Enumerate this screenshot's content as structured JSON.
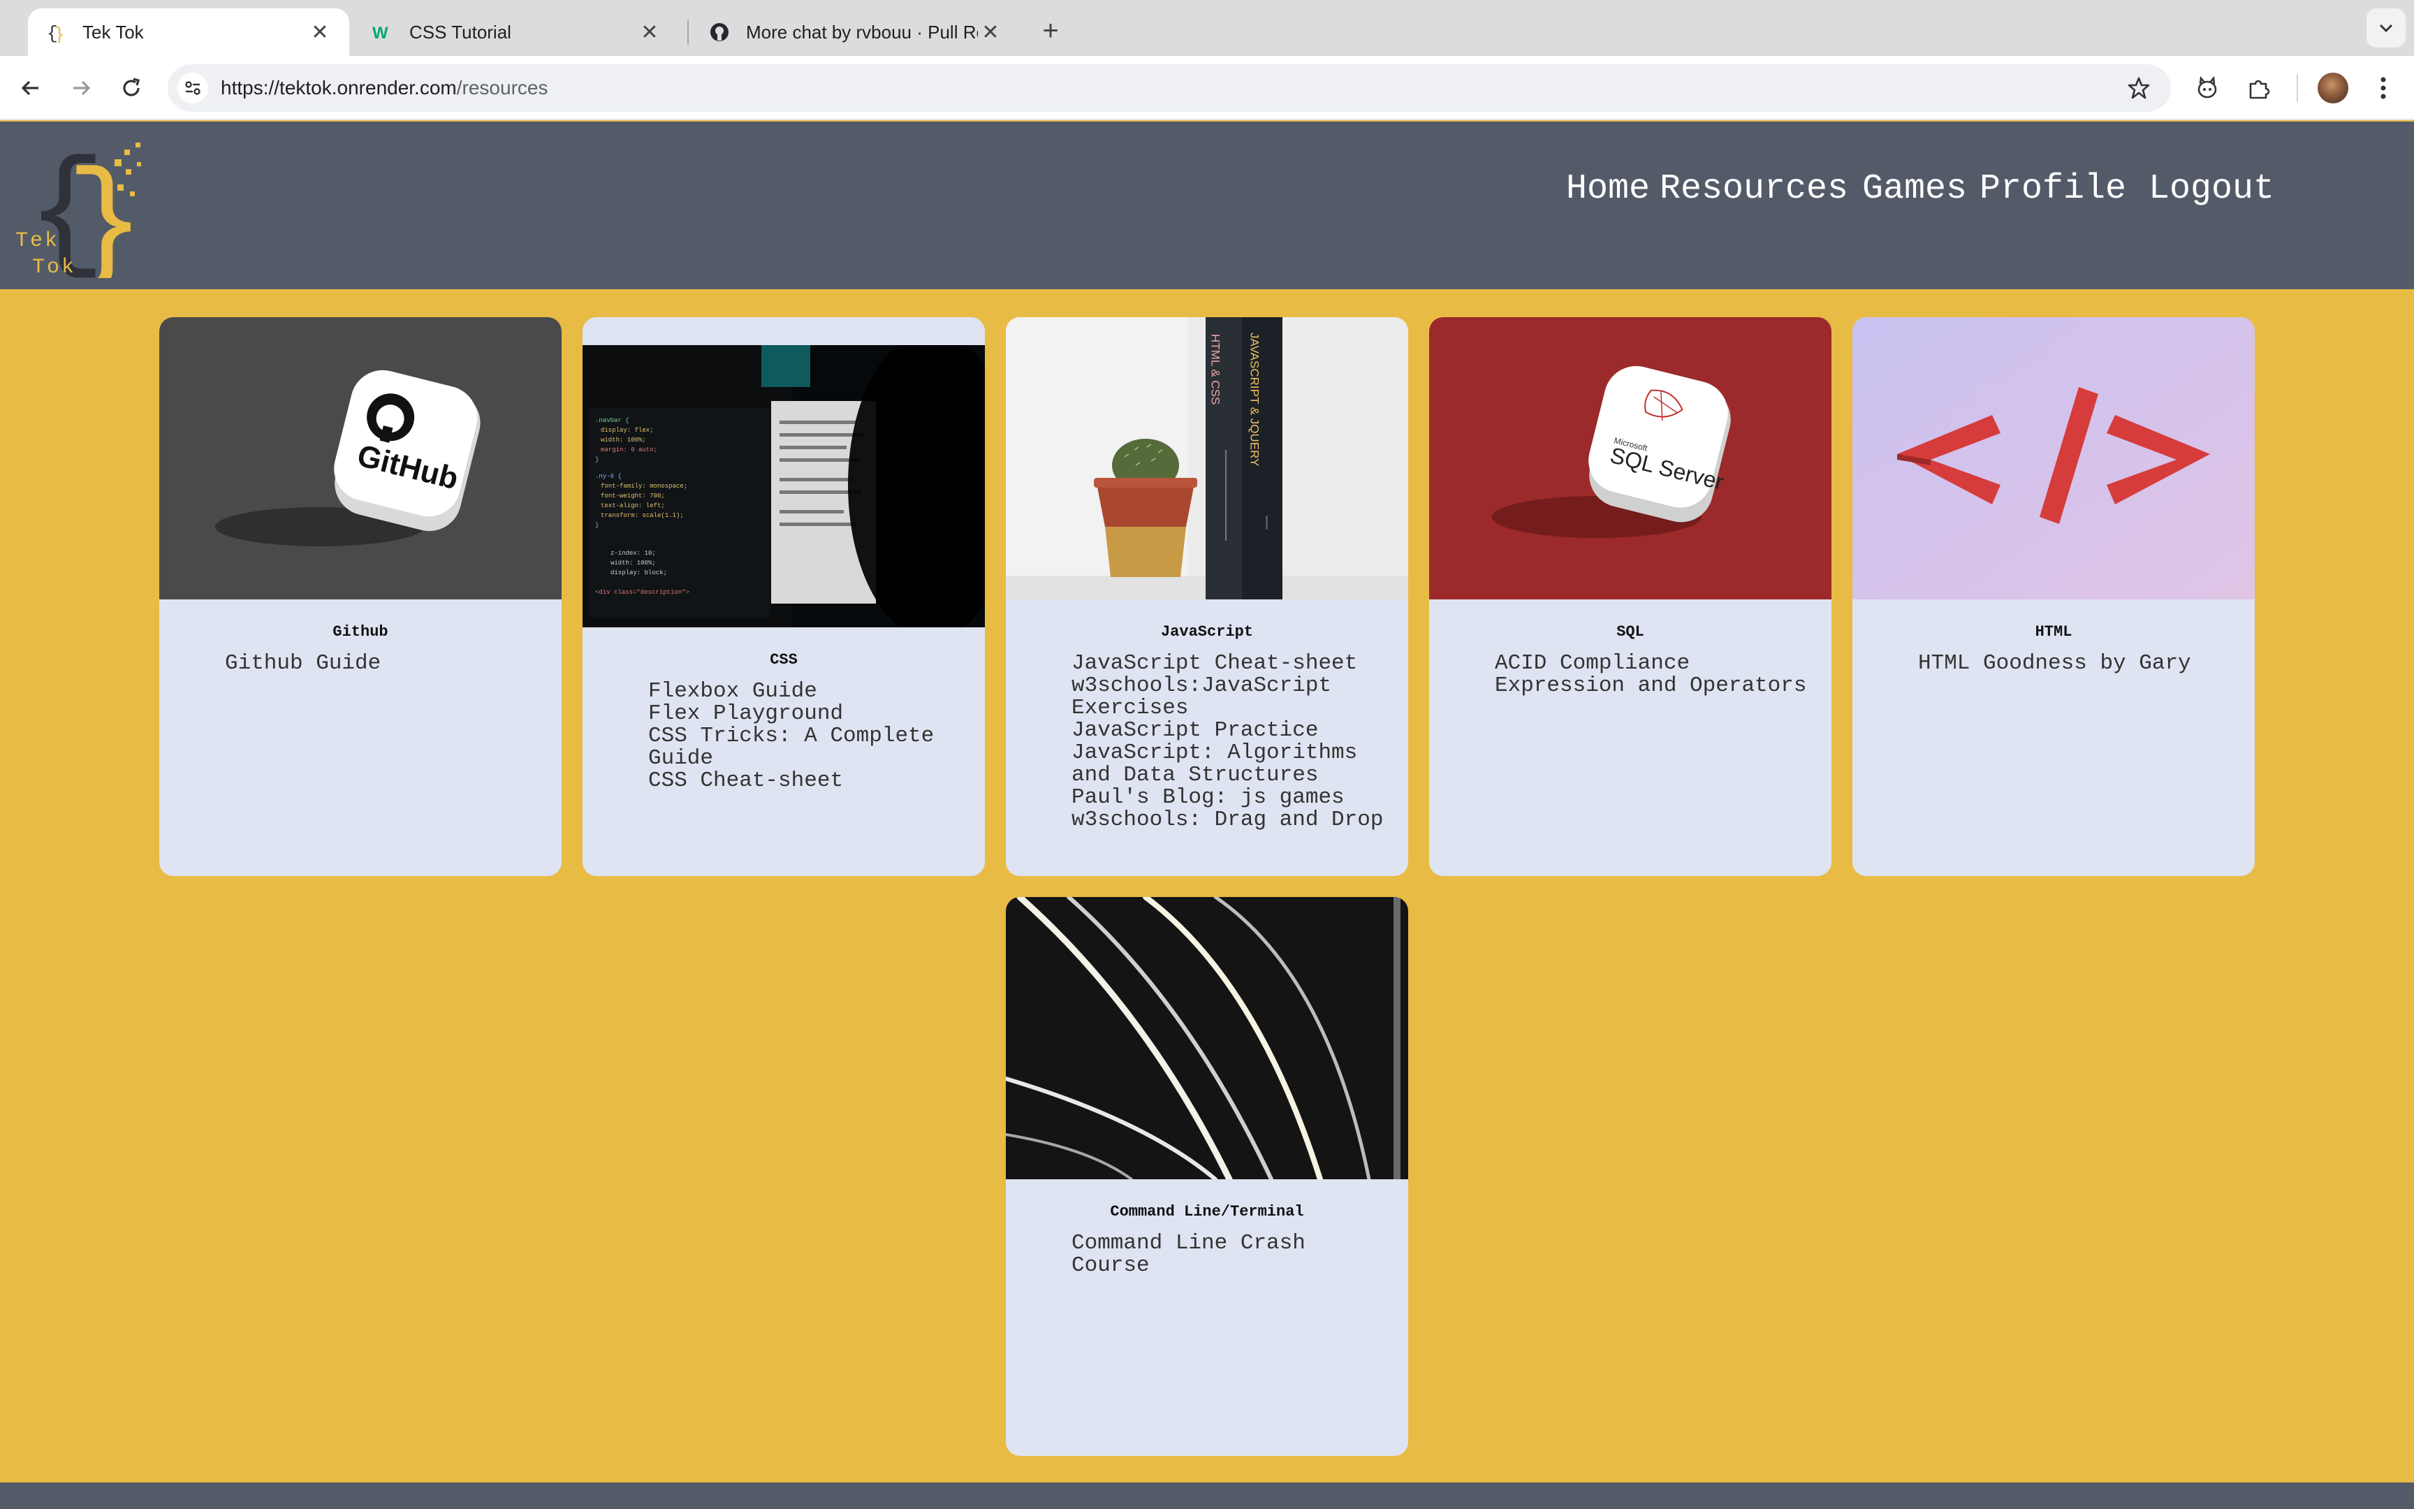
{
  "browser": {
    "tabs": [
      {
        "title": "Tek Tok",
        "active": true
      },
      {
        "title": "CSS Tutorial",
        "active": false
      },
      {
        "title": "More chat by rvbouu · Pull Re",
        "active": false
      }
    ],
    "url_host": "https://tektok.onrender.com",
    "url_path": "/resources",
    "icons": [
      "back-icon",
      "forward-icon",
      "reload-icon",
      "site-settings-icon",
      "bookmark-star-icon",
      "extension-icon",
      "puzzle-icon",
      "profile-avatar",
      "kebab-menu-icon"
    ]
  },
  "site": {
    "logo_text_1": "Tek",
    "logo_text_2": "Tok",
    "nav": {
      "home": "Home",
      "resources": "Resources",
      "games": "Games",
      "profile": "Profile",
      "logout": "Logout"
    }
  },
  "cards": [
    {
      "title": "Github",
      "links": [
        "Github Guide"
      ],
      "image": "github-logo-image"
    },
    {
      "title": "CSS",
      "links": [
        "Flexbox Guide",
        "Flex Playground",
        "CSS Tricks: A Complete Guide",
        "CSS Cheat-sheet"
      ],
      "image": "code-screen-image"
    },
    {
      "title": "JavaScript",
      "links": [
        "JavaScript Cheat-sheet",
        "w3schools:JavaScript Exercises",
        "JavaScript Practice",
        "JavaScript: Algorithms and Data Structures",
        "Paul's Blog: js games",
        "w3schools: Drag and Drop"
      ],
      "image": "books-cactus-image"
    },
    {
      "title": "SQL",
      "links": [
        "ACID Compliance",
        "Expression and Operators"
      ],
      "image": "sql-server-image"
    },
    {
      "title": "HTML",
      "links": [
        "HTML Goodness by Gary"
      ],
      "image": "html-tag-image"
    },
    {
      "title": "Command Line/Terminal",
      "links": [
        "Command Line Crash Course"
      ],
      "image": "light-curves-image"
    }
  ],
  "colors": {
    "page_bg": "#e8bb45",
    "header_bg": "#545b68",
    "card_bg": "#dfe4f2",
    "accent": "#e8bb45"
  }
}
